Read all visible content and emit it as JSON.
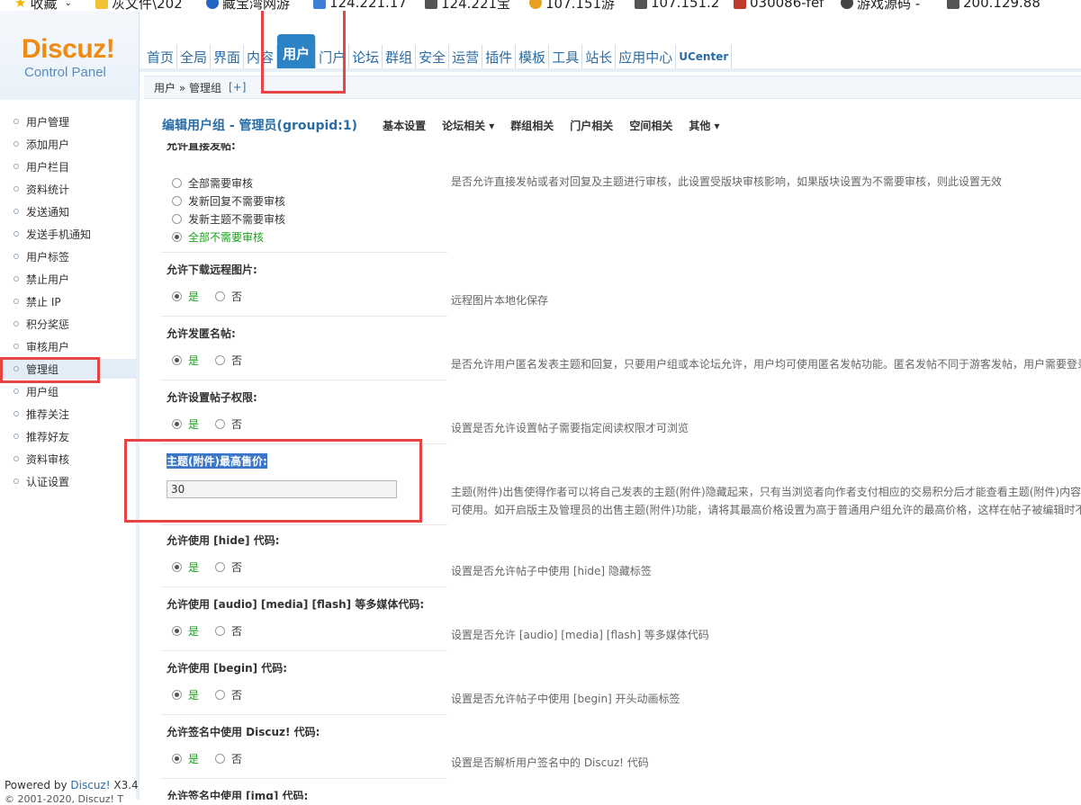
{
  "bookmarks": [
    {
      "label": "收藏",
      "icon": "star-icon",
      "color": "#f1b500"
    },
    {
      "label": "灰文件\\202",
      "icon": "folder-icon",
      "color": "#f2c233"
    },
    {
      "label": "藏宝湾网游",
      "icon": "site-icon",
      "color": "#2166c3"
    },
    {
      "label": "124.221.17",
      "icon": "site-icon",
      "color": "#3d7fd6"
    },
    {
      "label": "124.221宝",
      "icon": "page-icon",
      "color": "#555555"
    },
    {
      "label": "107.151游",
      "icon": "site-icon",
      "color": "#e8a020"
    },
    {
      "label": "107.151.2",
      "icon": "page-icon",
      "color": "#555555"
    },
    {
      "label": "030086-fef",
      "icon": "site-icon",
      "color": "#c0392b"
    },
    {
      "label": "游戏源码 -",
      "icon": "wordpress-icon",
      "color": "#444444"
    },
    {
      "label": "200.129.88",
      "icon": "page-icon",
      "color": "#555555"
    }
  ],
  "logo": {
    "brand": "Discuz!",
    "sub": "Control Panel"
  },
  "nav": {
    "items": [
      "首页",
      "全局",
      "界面",
      "内容",
      "用户",
      "门户",
      "论坛",
      "群组",
      "安全",
      "运营",
      "插件",
      "模板",
      "工具",
      "站长",
      "应用中心",
      "UCenter"
    ],
    "active": "用户"
  },
  "breadcrumb": {
    "path": "用户 » 管理组",
    "plus": "[+]"
  },
  "sidebar": {
    "items": [
      "用户管理",
      "添加用户",
      "用户栏目",
      "资料统计",
      "发送通知",
      "发送手机通知",
      "用户标签",
      "禁止用户",
      "禁止 IP",
      "积分奖惩",
      "审核用户",
      "管理组",
      "用户组",
      "推荐关注",
      "推荐好友",
      "资料审核",
      "认证设置"
    ],
    "active": "管理组",
    "powered_prefix": "Powered by",
    "powered_brand": "Discuz!",
    "powered_version": "X3.4",
    "copyright": "© 2001-2020, Discuz! T"
  },
  "page": {
    "title": "编辑用户组 - 管理员(groupid:1)",
    "tabs": [
      "基本设置",
      "论坛相关 ▾",
      "群组相关",
      "门户相关",
      "空间相关",
      "其他 ▾"
    ]
  },
  "settings": {
    "direct_post": {
      "label": "允许直接发帖:",
      "options": [
        "全部需要审核",
        "发新回复不需要审核",
        "发新主题不需要审核",
        "全部不需要审核"
      ],
      "selected": 3,
      "desc": "是否允许直接发帖或者对回复及主题进行审核，此设置受版块审核影响，如果版块设置为不需要审核，则此设置无效"
    },
    "remote_images": {
      "label": "允许下载远程图片:",
      "yes": "是",
      "no": "否",
      "desc": "远程图片本地化保存"
    },
    "anonymous_post": {
      "label": "允许发匿名帖:",
      "yes": "是",
      "no": "否",
      "desc": "是否允许用户匿名发表主题和回复，只要用户组或本论坛允许，用户均可使用匿名发帖功能。匿名发帖不同于游客发帖，用户需要登录"
    },
    "post_permission": {
      "label": "允许设置帖子权限:",
      "yes": "是",
      "no": "否",
      "desc": "设置是否允许设置帖子需要指定阅读权限才可浏览"
    },
    "max_price": {
      "label": "主题(附件)最高售价:",
      "value": "30",
      "desc1": "主题(附件)出售使得作者可以将自己发表的主题(附件)隐藏起来，只有当浏览者向作者支付相应的交易积分后才能查看主题(附件)内容",
      "desc2": "可使用。如开启版主及管理员的出售主题(附件)功能，请将其最高价格设置为高于普通用户组允许的最高价格，这样在帖子被编辑时不"
    },
    "hide_code": {
      "label": "允许使用 [hide] 代码:",
      "yes": "是",
      "no": "否",
      "desc": "设置是否允许帖子中使用 [hide] 隐藏标签"
    },
    "media_code": {
      "label": "允许使用 [audio] [media] [flash] 等多媒体代码:",
      "yes": "是",
      "no": "否",
      "desc": "设置是否允许 [audio] [media] [flash] 等多媒体代码"
    },
    "begin_code": {
      "label": "允许使用 [begin] 代码:",
      "yes": "是",
      "no": "否",
      "desc": "设置是否允许帖子中使用 [begin] 开头动画标签"
    },
    "sig_discuz": {
      "label": "允许签名中使用 Discuz! 代码:",
      "yes": "是",
      "no": "否",
      "desc": "设置是否解析用户签名中的 Discuz! 代码"
    },
    "sig_img": {
      "label": "允许签名中使用 [img] 代码:"
    }
  },
  "colors": {
    "accent": "#2b82c5",
    "logo": "#f08a10",
    "highlight_box": "#e54545",
    "selected_option": "#19a019"
  }
}
